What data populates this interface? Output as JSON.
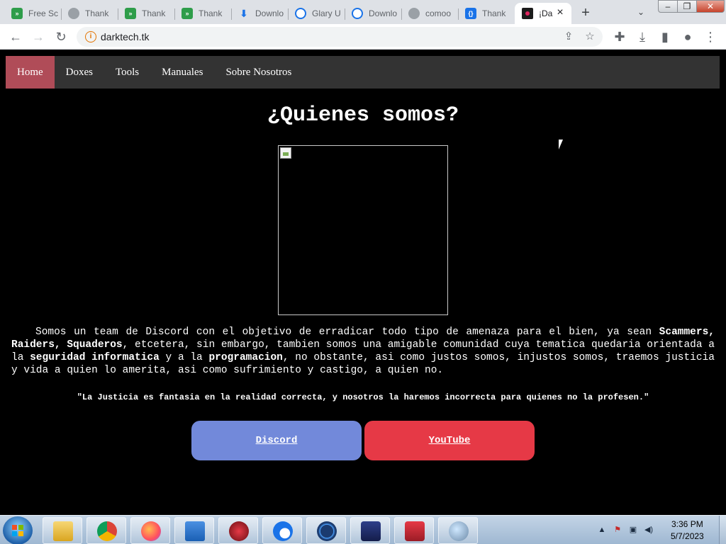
{
  "browser": {
    "tabs": [
      {
        "title": "Free Sc",
        "icon": "green"
      },
      {
        "title": "Thank",
        "icon": "grey"
      },
      {
        "title": "Thank",
        "icon": "green"
      },
      {
        "title": "Thank",
        "icon": "green"
      },
      {
        "title": "Downlo",
        "icon": "blue-dl"
      },
      {
        "title": "Glary U",
        "icon": "edge"
      },
      {
        "title": "Downlo",
        "icon": "edge"
      },
      {
        "title": "comoo",
        "icon": "grey"
      },
      {
        "title": "Thank",
        "icon": "blue"
      },
      {
        "title": "¡Da",
        "icon": "dark",
        "active": true
      }
    ],
    "url": "darktech.tk"
  },
  "site": {
    "nav": [
      "Home",
      "Doxes",
      "Tools",
      "Manuales",
      "Sobre Nosotros"
    ],
    "title": "¿Quienes somos?",
    "desc": {
      "p1": "Somos un team de Discord con el objetivo de erradicar todo tipo de amenaza para el bien, ya sean ",
      "b1": "Scammers, Raiders, Squaderos",
      "p2": ", etcetera, sin embargo, tambien somos una amigable comunidad cuya tematica quedaria orientada a la ",
      "b2": "seguridad informatica",
      "p3": " y a la ",
      "b3": "programacion",
      "p4": ", no obstante, asi como justos somos, injustos somos, traemos justicia y vida a quien lo amerita, asi como sufrimiento y castigo, a quien no."
    },
    "quote": "\"La Justicia es fantasia en la realidad correcta, y nosotros la haremos incorrecta para quienes no la profesen.\"",
    "buttons": {
      "discord": "Discord",
      "youtube": "YouTube"
    },
    "colors": {
      "nav_active": "#b04c58",
      "discord": "#7289da",
      "youtube": "#e63946"
    }
  },
  "taskbar": {
    "apps": [
      "file-explorer",
      "chrome",
      "firefox",
      "arch",
      "app-red",
      "app-wave",
      "ccleaner",
      "app-image",
      "screen-recorder",
      "network-app"
    ],
    "time": "3:36 PM",
    "date": "5/7/2023"
  }
}
